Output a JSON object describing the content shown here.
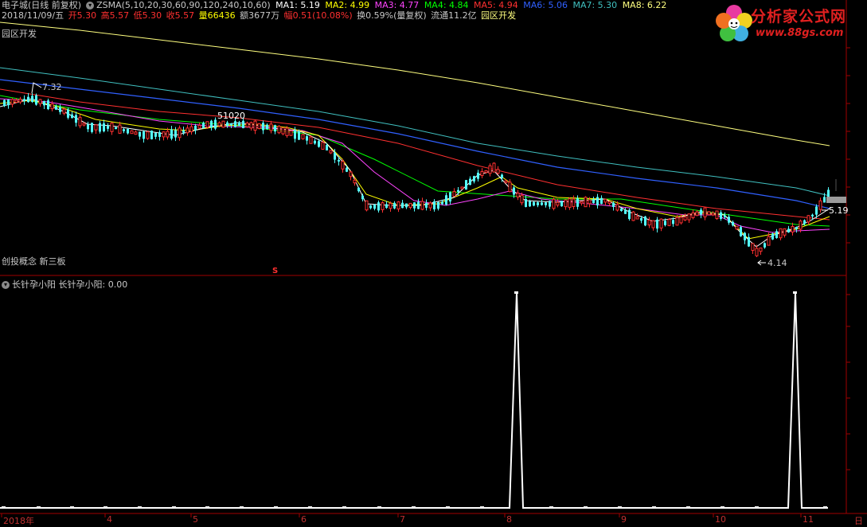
{
  "header": {
    "stock_name": "电子城(日线 前复权)",
    "formula": "ZSMA(5,10,20,30,60,90,120,240,10,60)",
    "ma": [
      {
        "label": "MA1: 5.19",
        "color": "#ffffff"
      },
      {
        "label": "MA2: 4.99",
        "color": "#ffff00"
      },
      {
        "label": "MA3: 4.77",
        "color": "#ff44ff"
      },
      {
        "label": "MA4: 4.84",
        "color": "#00ff00"
      },
      {
        "label": "MA5: 4.94",
        "color": "#ff3030"
      },
      {
        "label": "MA6: 5.06",
        "color": "#3060ff"
      },
      {
        "label": "MA7: 5.30",
        "color": "#40c0c0"
      },
      {
        "label": "MA8: 6.22",
        "color": "#ffff80"
      }
    ]
  },
  "info_row": {
    "date": "2018/11/09/五",
    "open": "开5.30",
    "high": "高5.57",
    "low": "低5.30",
    "close": "收5.57",
    "volume": "量66436",
    "amount": "额3677万",
    "change": "幅0.51(10.08%)",
    "turnover": "换0.59%(量复权)",
    "float": "流通11.2亿",
    "sector": "园区开发"
  },
  "sector_label": "园区开发",
  "concept_label": "创投概念 新三板",
  "annotations": {
    "high_point": "7.32",
    "volume_mark": "51020",
    "low_point": "4.14",
    "last_price": "5.19",
    "s_mark": "S"
  },
  "indicator": {
    "name": "长针孕小阳",
    "value_text": "长针孕小阳: 0.00"
  },
  "x_axis": [
    "2018年",
    "4",
    "5",
    "6",
    "7",
    "8",
    "9",
    "10",
    "11"
  ],
  "right_axis_unit": "日",
  "logo": {
    "title": "分析家公式网",
    "url": "www.88gs.com"
  },
  "colors": {
    "up": "#ff3030",
    "down": "#54ffff",
    "border": "#a00000",
    "axis_text": "#c03030"
  }
}
